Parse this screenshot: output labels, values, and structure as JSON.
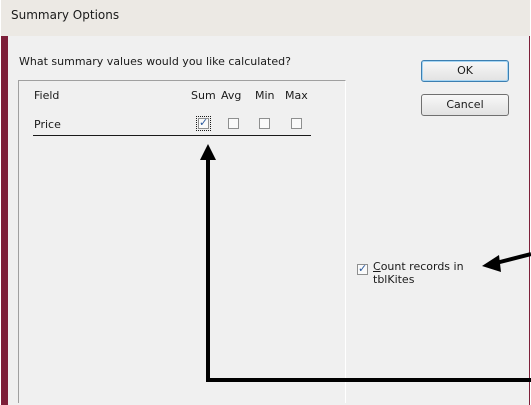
{
  "window": {
    "title": "Summary Options"
  },
  "prompt": "What summary values would you like calculated?",
  "table": {
    "headers": {
      "field": "Field",
      "sum": "Sum",
      "avg": "Avg",
      "min": "Min",
      "max": "Max"
    },
    "rows": [
      {
        "field": "Price",
        "sum": true,
        "avg": false,
        "min": false,
        "max": false
      }
    ]
  },
  "buttons": {
    "ok": "OK",
    "cancel": "Cancel"
  },
  "count_records": {
    "mnemonic": "C",
    "rest": "ount records in",
    "line2": "tblKites",
    "checked": true
  }
}
